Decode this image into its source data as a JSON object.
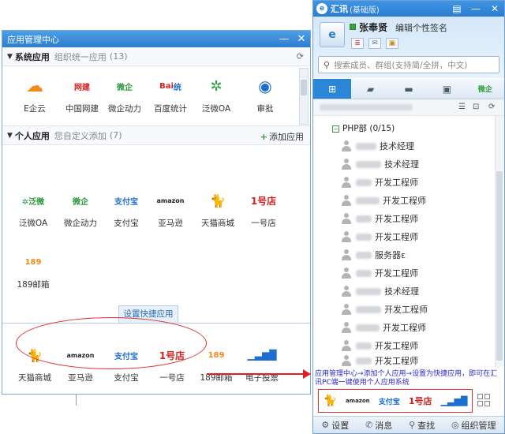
{
  "app_manager": {
    "title": "应用管理中心",
    "system_section": {
      "name": "系统应用",
      "sub": "组织统一应用",
      "count": "(13)"
    },
    "personal_section": {
      "name": "个人应用",
      "sub": "您自定义添加",
      "count": "(7)",
      "add_label": "添加应用"
    },
    "system_apps": [
      {
        "label": "E企云",
        "icon": "cloud-icon",
        "glyph": "☁"
      },
      {
        "label": "中国网建",
        "icon": "china-web-icon",
        "glyph": "网建"
      },
      {
        "label": "微企动力",
        "icon": "weiqi-icon",
        "glyph": "微企"
      },
      {
        "label": "百度统计",
        "icon": "baidu-icon",
        "glyph": "Bai统"
      },
      {
        "label": "泛微OA",
        "icon": "fanwei-icon",
        "glyph": "✲"
      },
      {
        "label": "审批",
        "icon": "approval-icon",
        "glyph": "◉"
      }
    ],
    "personal_apps": [
      {
        "label": "泛微OA",
        "icon": "fanwei-icon",
        "glyph": "✲泛微"
      },
      {
        "label": "微企动力",
        "icon": "weiqi-icon",
        "glyph": "微企"
      },
      {
        "label": "支付宝",
        "icon": "alipay-icon",
        "glyph": "支付宝"
      },
      {
        "label": "亚马逊",
        "icon": "amazon-icon",
        "glyph": "amazon"
      },
      {
        "label": "天猫商城",
        "icon": "tmall-icon",
        "glyph": "猫"
      },
      {
        "label": "一号店",
        "icon": "yhd-icon",
        "glyph": "1号店"
      },
      {
        "label": "189邮箱",
        "icon": "mail189-icon",
        "glyph": "189"
      }
    ],
    "shortcut_tab": "设置快捷应用",
    "shortcut_apps": [
      {
        "label": "天猫商城",
        "icon": "tmall-icon",
        "glyph": "猫"
      },
      {
        "label": "亚马逊",
        "icon": "amazon-icon",
        "glyph": "amazon"
      },
      {
        "label": "支付宝",
        "icon": "alipay-icon",
        "glyph": "支付宝"
      },
      {
        "label": "一号店",
        "icon": "yhd-icon",
        "glyph": "1号店"
      },
      {
        "label": "189邮箱",
        "icon": "mail189-icon",
        "glyph": "189"
      },
      {
        "label": "电子投票",
        "icon": "vote-icon",
        "glyph": "▁▃▆█"
      }
    ]
  },
  "huixun": {
    "brand": "汇讯",
    "edition": "(基础版)",
    "user_name": "张奉贤",
    "signature": "编辑个性签名",
    "search_placeholder": "搜索成员、群组(支持简/全拼，中文)",
    "department": "PHP部 (0/15)",
    "members": [
      {
        "title": "技术经理"
      },
      {
        "title": "技术经理"
      },
      {
        "title": "开发工程师"
      },
      {
        "title": "开发工程师"
      },
      {
        "title": "开发工程师"
      },
      {
        "title": "开发工程师"
      },
      {
        "title": "服务器ε"
      },
      {
        "title": "开发工程师"
      },
      {
        "title": "技术经理"
      },
      {
        "title": "开发工程师"
      },
      {
        "title": "开发工程师"
      },
      {
        "title": "开发工程师"
      },
      {
        "title": "开发工程师"
      }
    ],
    "notice": "应用管理中心→添加个人应用→设置为快捷应用，即可在汇讯PC端一键使用个人应用系统",
    "bottom": {
      "settings": "设置",
      "messages": "消息",
      "find": "查找",
      "org": "组织管理"
    }
  }
}
